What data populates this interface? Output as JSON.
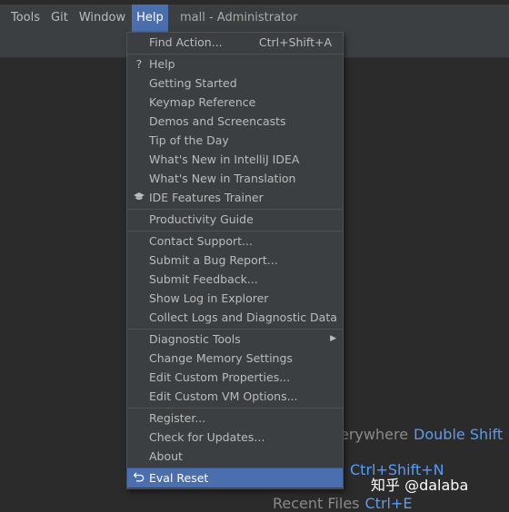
{
  "menubar": {
    "items": [
      {
        "label": "Tools"
      },
      {
        "label": "Git"
      },
      {
        "label": "Window"
      },
      {
        "label": "Help"
      }
    ],
    "window_title": "mall - Administrator"
  },
  "help_menu": {
    "find_action": {
      "label": "Find Action...",
      "shortcut": "Ctrl+Shift+A"
    },
    "items": [
      {
        "label": "Help",
        "icon": "question-icon"
      },
      {
        "label": "Getting Started"
      },
      {
        "label": "Keymap Reference"
      },
      {
        "label": "Demos and Screencasts"
      },
      {
        "label": "Tip of the Day"
      },
      {
        "label": "What's New in IntelliJ IDEA"
      },
      {
        "label": "What's New in Translation"
      },
      {
        "label": "IDE Features Trainer",
        "icon": "graduation-cap-icon"
      },
      {
        "label": "Productivity Guide"
      },
      {
        "label": "Contact Support..."
      },
      {
        "label": "Submit a Bug Report..."
      },
      {
        "label": "Submit Feedback..."
      },
      {
        "label": "Show Log in Explorer"
      },
      {
        "label": "Collect Logs and Diagnostic Data"
      },
      {
        "label": "Diagnostic Tools",
        "submenu": true
      },
      {
        "label": "Change Memory Settings"
      },
      {
        "label": "Edit Custom Properties..."
      },
      {
        "label": "Edit Custom VM Options..."
      },
      {
        "label": "Register..."
      },
      {
        "label": "Check for Updates..."
      },
      {
        "label": "About"
      },
      {
        "label": "Eval Reset",
        "icon": "undo-icon",
        "selected": true
      }
    ]
  },
  "editor_hints": {
    "search_everywhere": {
      "label": "erywhere",
      "shortcut": "Double Shift"
    },
    "goto_file": {
      "label": "",
      "shortcut": "Ctrl+Shift+N"
    },
    "recent_files": {
      "label": "Recent Files",
      "shortcut": "Ctrl+E"
    }
  },
  "watermark": "知乎 @dalaba",
  "colors": {
    "background": "#2b2b2b",
    "menu_bg": "#3c3f41",
    "selection": "#4b6eaf",
    "shortcut_blue": "#589df6"
  }
}
